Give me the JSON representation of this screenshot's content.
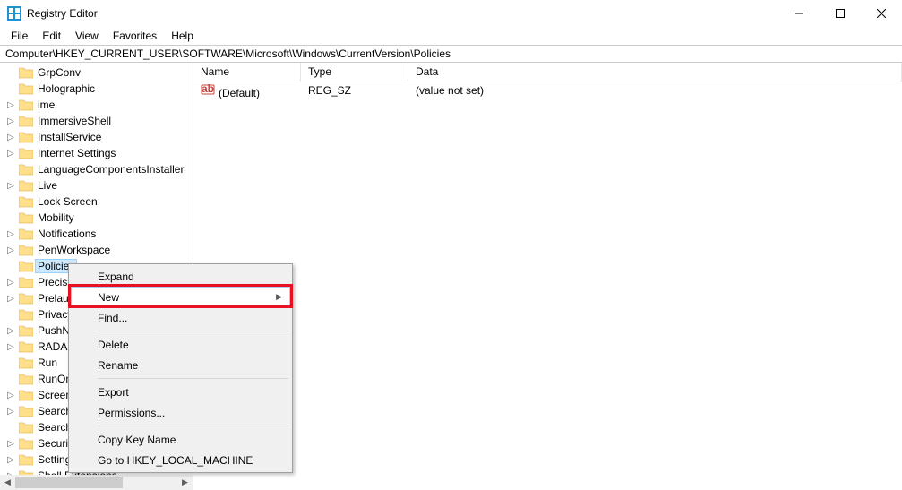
{
  "title": "Registry Editor",
  "menubar": [
    "File",
    "Edit",
    "View",
    "Favorites",
    "Help"
  ],
  "address": "Computer\\HKEY_CURRENT_USER\\SOFTWARE\\Microsoft\\Windows\\CurrentVersion\\Policies",
  "tree": [
    {
      "label": "GrpConv",
      "expandable": false
    },
    {
      "label": "Holographic",
      "expandable": false
    },
    {
      "label": "ime",
      "expandable": true
    },
    {
      "label": "ImmersiveShell",
      "expandable": true
    },
    {
      "label": "InstallService",
      "expandable": true
    },
    {
      "label": "Internet Settings",
      "expandable": true
    },
    {
      "label": "LanguageComponentsInstaller",
      "expandable": false
    },
    {
      "label": "Live",
      "expandable": true
    },
    {
      "label": "Lock Screen",
      "expandable": false
    },
    {
      "label": "Mobility",
      "expandable": false
    },
    {
      "label": "Notifications",
      "expandable": true
    },
    {
      "label": "PenWorkspace",
      "expandable": true
    },
    {
      "label": "Policies",
      "expandable": false,
      "selected": true
    },
    {
      "label": "PrecisionTouchPad",
      "expandable": true
    },
    {
      "label": "Prelaunch",
      "expandable": true
    },
    {
      "label": "Privacy",
      "expandable": false
    },
    {
      "label": "PushNotifications",
      "expandable": true
    },
    {
      "label": "RADAR",
      "expandable": true
    },
    {
      "label": "Run",
      "expandable": false
    },
    {
      "label": "RunOnce",
      "expandable": false
    },
    {
      "label": "Screensavers",
      "expandable": true
    },
    {
      "label": "Search",
      "expandable": true
    },
    {
      "label": "SearchSettings",
      "expandable": false
    },
    {
      "label": "Security and Maintenance",
      "expandable": true
    },
    {
      "label": "SettingSync",
      "expandable": true
    },
    {
      "label": "Shell Extensions",
      "expandable": true
    }
  ],
  "columns": {
    "name": "Name",
    "type": "Type",
    "data": "Data"
  },
  "rows": [
    {
      "name": "(Default)",
      "type": "REG_SZ",
      "data": "(value not set)"
    }
  ],
  "context_menu": {
    "items": [
      {
        "label": "Expand",
        "hovered": false
      },
      {
        "label": "New",
        "submenu": true,
        "hovered": true
      },
      {
        "label": "Find...",
        "hovered": false
      },
      {
        "sep": true
      },
      {
        "label": "Delete",
        "hovered": false
      },
      {
        "label": "Rename",
        "hovered": false
      },
      {
        "sep": true
      },
      {
        "label": "Export",
        "hovered": false
      },
      {
        "label": "Permissions...",
        "hovered": false
      },
      {
        "sep": true
      },
      {
        "label": "Copy Key Name",
        "hovered": false
      },
      {
        "label": "Go to HKEY_LOCAL_MACHINE",
        "hovered": false
      }
    ]
  }
}
